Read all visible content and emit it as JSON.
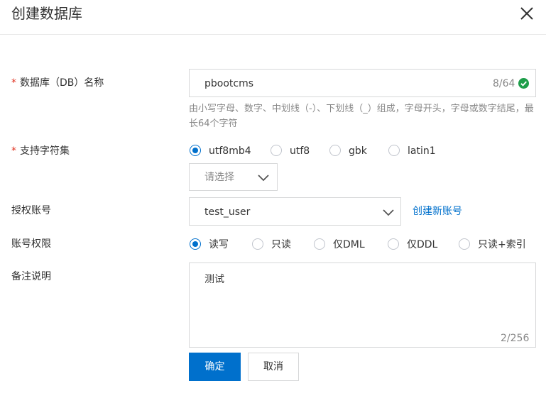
{
  "dialog": {
    "title": "创建数据库"
  },
  "form": {
    "db_name": {
      "required_mark": "*",
      "label": "数据库（DB）名称",
      "value": "pbootcms",
      "counter": "8/64",
      "help": "由小写字母、数字、中划线（-）、下划线（_）组成，字母开头，字母或数字结尾，最长64个字符"
    },
    "charset": {
      "required_mark": "*",
      "label": "支持字符集",
      "options": [
        "utf8mb4",
        "utf8",
        "gbk",
        "latin1"
      ],
      "selected": "utf8mb4",
      "select_placeholder": "请选择"
    },
    "account": {
      "label": "授权账号",
      "value": "test_user",
      "create_link": "创建新账号"
    },
    "permission": {
      "label": "账号权限",
      "options": [
        "读写",
        "只读",
        "仅DML",
        "仅DDL",
        "只读+索引"
      ],
      "selected": "读写"
    },
    "remark": {
      "label": "备注说明",
      "value": "测试",
      "counter": "2/256"
    }
  },
  "buttons": {
    "confirm": "确定",
    "cancel": "取消"
  },
  "colors": {
    "primary": "#0070cc",
    "required": "#e0301e",
    "success": "#1e9e4a"
  },
  "icons": {
    "close": "close-icon",
    "valid": "check-circle-icon",
    "dropdown": "chevron-down-icon"
  }
}
